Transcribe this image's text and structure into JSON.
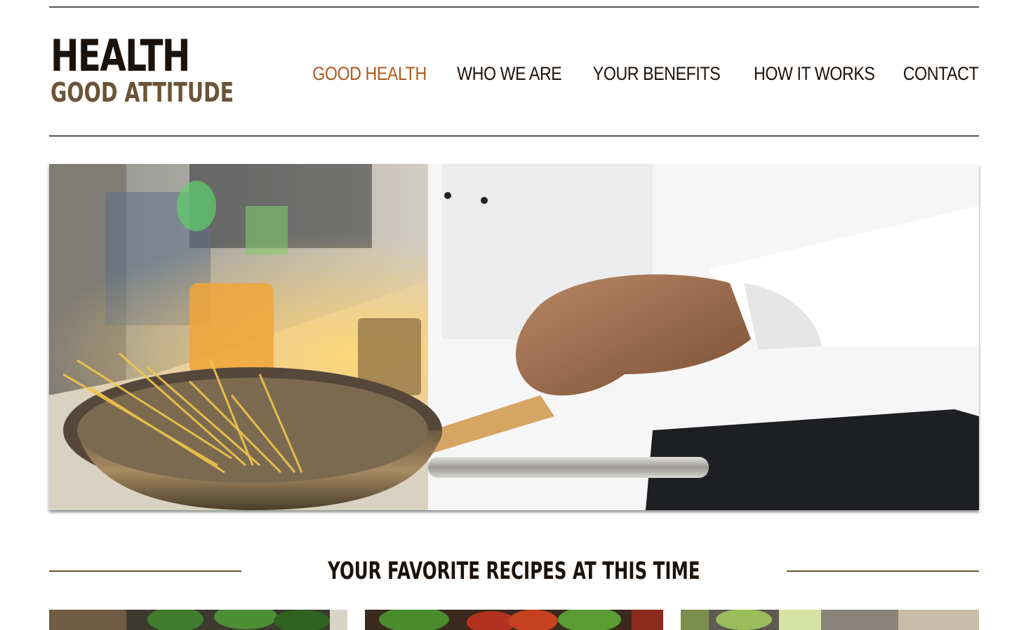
{
  "logo": {
    "main": "HEALTH",
    "sub": "GOOD ATTITUDE"
  },
  "nav": {
    "items": [
      {
        "label": "GOOD HEALTH",
        "active": true
      },
      {
        "label": "WHO WE ARE",
        "active": false
      },
      {
        "label": "YOUR BENEFITS",
        "active": false
      },
      {
        "label": "HOW IT WORKS",
        "active": false
      },
      {
        "label": "CONTACT",
        "active": false
      }
    ]
  },
  "colors": {
    "accent": "#b0581c",
    "brand_dark": "#1b120c",
    "brand_brown": "#6b5435"
  },
  "hero": {
    "image": "chef-cooking-spaghetti-in-wok-photo"
  },
  "section": {
    "title": "YOUR FAVORITE RECIPES AT THIS TIME"
  },
  "recipes": [
    {
      "image": "leafy-greens-photo"
    },
    {
      "image": "vegetables-tomatoes-photo"
    },
    {
      "image": "celery-cutting-board-photo"
    }
  ]
}
